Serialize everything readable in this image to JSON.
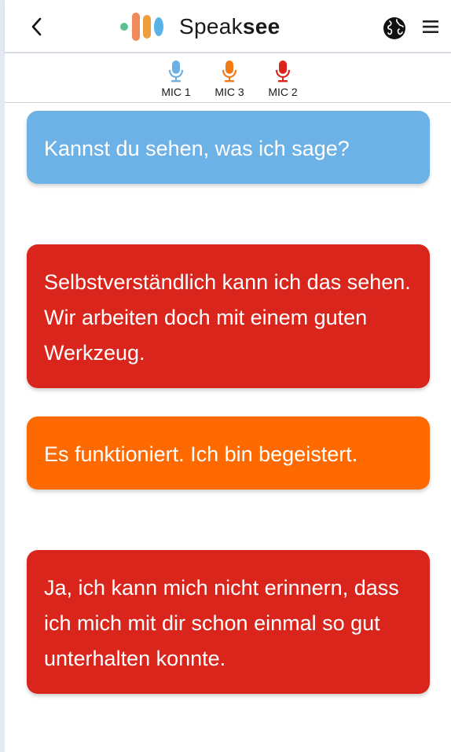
{
  "header": {
    "logo_text_light": "Speak",
    "logo_text_bold": "see",
    "logo_colors": [
      "#5cc28d",
      "#f08a5d",
      "#ee9e3e",
      "#5ab3e8"
    ]
  },
  "mics": [
    {
      "label": "MIC 1",
      "color": "#6cb0e3",
      "icon": "microphone-icon"
    },
    {
      "label": "MIC 3",
      "color": "#f27a14",
      "icon": "microphone-icon"
    },
    {
      "label": "MIC 2",
      "color": "#d9251b",
      "icon": "microphone-icon"
    }
  ],
  "messages": [
    {
      "text": "Kannst du sehen, was ich sage?",
      "color": "#6cb2e6",
      "speaker": "MIC 1"
    },
    {
      "text": "Selbstverständlich kann ich das sehen. Wir arbeiten doch mit einem guten Werkzeug.",
      "color": "#d9251b",
      "speaker": "MIC 2"
    },
    {
      "text": "Es funktioniert. Ich bin begeis­tert.",
      "color": "#ff6a00",
      "speaker": "MIC 3"
    },
    {
      "text": "Ja, ich kann mich nicht erin­nern, dass ich mich mit dir schon einmal so gut unterhal­ten konnte.",
      "color": "#d9251b",
      "speaker": "MIC 2"
    }
  ]
}
